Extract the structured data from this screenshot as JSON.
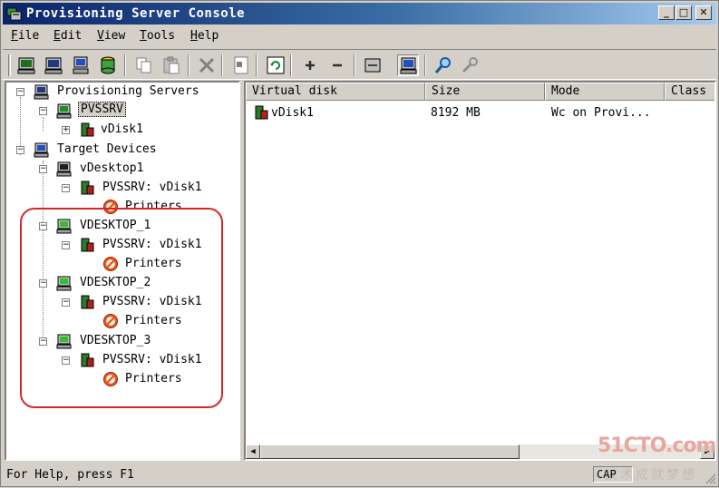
{
  "window": {
    "title": "Provisioning Server Console",
    "minimize_glyph": "_",
    "maximize_glyph": "□",
    "close_glyph": "✕"
  },
  "menu": {
    "file": {
      "key": "F",
      "rest": "ile"
    },
    "edit": {
      "key": "E",
      "rest": "dit"
    },
    "view": {
      "key": "V",
      "rest": "iew"
    },
    "tools": {
      "key": "T",
      "rest": "ools"
    },
    "help": {
      "key": "H",
      "rest": "elp"
    }
  },
  "toolbar": {
    "icons": [
      "server-icon",
      "server-stop-icon",
      "device-icon",
      "vdisk-icon",
      "copy-icon",
      "paste-icon",
      "delete-icon",
      "properties-icon",
      "refresh-icon",
      "add-icon",
      "remove-icon",
      "help-icon",
      "device-view-icon",
      "search-icon",
      "tools-icon"
    ],
    "pressed": "device-view-icon"
  },
  "tree": {
    "provisioning_servers": "Provisioning Servers",
    "pvssrv": "PVSSRV",
    "vdisk1": "vDisk1",
    "target_devices": "Target Devices",
    "devices": [
      {
        "name": "vDesktop1",
        "disk": "PVSSRV: vDisk1",
        "printers": "Printers"
      },
      {
        "name": "VDESKTOP_1",
        "disk": "PVSSRV: vDisk1",
        "printers": "Printers"
      },
      {
        "name": "VDESKTOP_2",
        "disk": "PVSSRV: vDisk1",
        "printers": "Printers"
      },
      {
        "name": "VDESKTOP_3",
        "disk": "PVSSRV: vDisk1",
        "printers": "Printers"
      }
    ]
  },
  "list": {
    "columns": [
      "Virtual disk",
      "Size",
      "Mode",
      "Class"
    ],
    "rows": [
      {
        "disk": "vDisk1",
        "size": "8192 MB",
        "mode": "Wc on Provi..."
      }
    ]
  },
  "status": {
    "text": "For Help, press F1",
    "cap": "CAP"
  },
  "watermark": {
    "logo": "51CTO.com",
    "slogan": "技术成就梦想"
  },
  "colors": {
    "title_start": "#0a246a",
    "title_end": "#a6caf0",
    "annotation": "#d42828",
    "chrome": "#d4d0c8"
  }
}
